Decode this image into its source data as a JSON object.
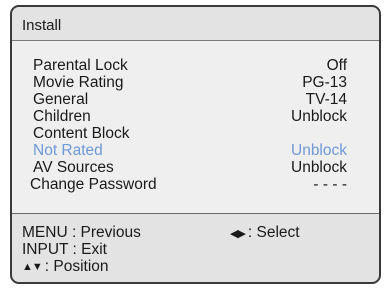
{
  "header": {
    "title": "Install"
  },
  "menu": {
    "rows": [
      {
        "label": "Parental Lock",
        "value": "Off"
      },
      {
        "label": "Movie Rating",
        "value": "PG-13"
      },
      {
        "label": "General",
        "value": "TV-14"
      },
      {
        "label": "Children",
        "value": "Unblock"
      },
      {
        "label": "Content Block",
        "value": ""
      },
      {
        "label": "Not Rated",
        "value": "Unblock"
      },
      {
        "label": "AV Sources",
        "value": "Unblock"
      },
      {
        "label": "Change Password",
        "value": "- - - -"
      }
    ],
    "selected_row": "Not Rated",
    "highlight_color": "#6f98d6"
  },
  "help": {
    "menu_hint": "MENU : Previous",
    "input_hint": "INPUT : Exit",
    "position_glyph": "▲▼",
    "position_label": ": Position",
    "select_glyph": "◀▶",
    "select_label": ": Select"
  }
}
